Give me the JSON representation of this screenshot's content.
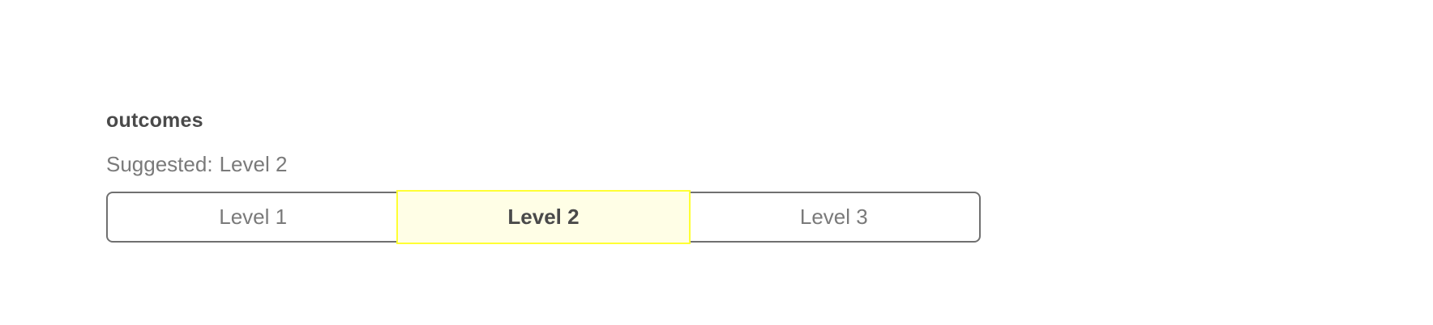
{
  "section": {
    "title": "outcomes",
    "suggested_label": "Suggested:",
    "suggested_value": "Level 2"
  },
  "levels": [
    {
      "label": "Level 1",
      "selected": false
    },
    {
      "label": "Level 2",
      "selected": true
    },
    {
      "label": "Level 3",
      "selected": false
    }
  ],
  "colors": {
    "selected_background": "#fffee6",
    "selected_border": "#ffff33",
    "control_border": "#707070",
    "title_text": "#4a4a4a",
    "muted_text": "#7a7a7a"
  }
}
